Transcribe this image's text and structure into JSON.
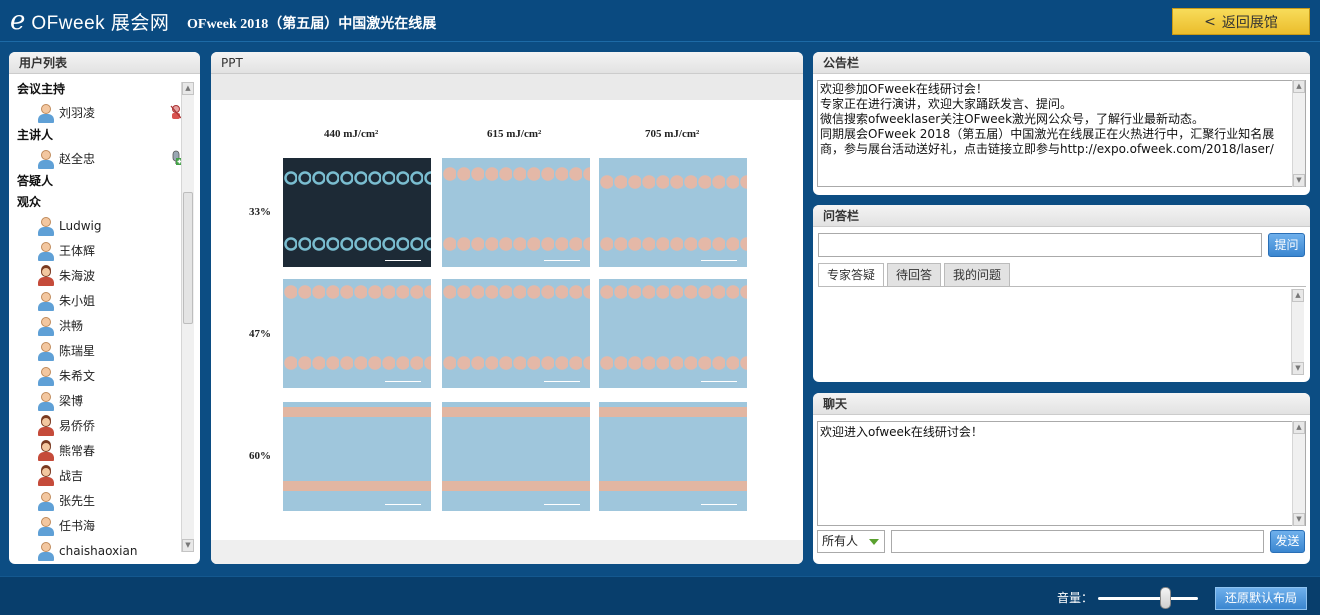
{
  "header": {
    "logo_text": "OFweek 展会网",
    "expo_title": "OFweek 2018（第五届）中国激光在线展",
    "back_button": "返回展馆"
  },
  "users_panel": {
    "title": "用户列表",
    "groups": {
      "host": "会议主持",
      "speaker": "主讲人",
      "answerer": "答疑人",
      "audience": "观众"
    },
    "host_user": "刘羽凌",
    "speaker_user": "赵全忠",
    "audience": [
      "Ludwig",
      "王体辉",
      "朱海波",
      "朱小姐",
      "洪畅",
      "陈瑞星",
      "朱希文",
      "梁博",
      "易侨侨",
      "熊常春",
      "战吉",
      "张先生",
      "任书海",
      "chaishaoxian"
    ]
  },
  "ppt_panel": {
    "title": "PPT",
    "columns": [
      "440 mJ/cm²",
      "615 mJ/cm²",
      "705 mJ/cm²"
    ],
    "rows": [
      "33%",
      "47%",
      "60%"
    ]
  },
  "notice_panel": {
    "title": "公告栏",
    "line1": "欢迎参加OFweek在线研讨会！",
    "line2": "专家正在进行演讲，欢迎大家踊跃发言、提问。",
    "line3": "微信搜索ofweeklaser关注OFweek激光网公众号，了解行业最新动态。",
    "line4": "同期展会OFweek 2018（第五届）中国激光在线展正在火热进行中，汇聚行业知名展",
    "line5": "商，参与展台活动送好礼，点击链接立即参与http://expo.ofweek.com/2018/laser/"
  },
  "qa_panel": {
    "title": "问答栏",
    "ask_button": "提问",
    "tabs": [
      "专家答疑",
      "待回答",
      "我的问题"
    ]
  },
  "chat_panel": {
    "title": "聊天",
    "welcome": "欢迎进入ofweek在线研讨会！",
    "recipient": "所有人",
    "send_button": "发送"
  },
  "footer": {
    "volume_label": "音量：",
    "volume_level": 0.65,
    "reset_layout_button": "还原默认布局"
  }
}
